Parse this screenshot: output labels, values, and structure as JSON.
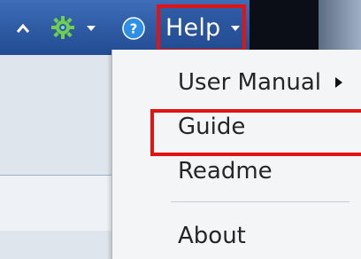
{
  "toolbar": {
    "icons": {
      "collapse": "caret-up-icon",
      "settings": "gear-icon",
      "settings_dropdown": "caret-down-icon",
      "help": "question-circle-icon"
    },
    "help_menu_label": "Help",
    "help_circle_glyph": "?"
  },
  "help_menu": {
    "items": [
      {
        "label": "User Manual",
        "has_submenu": true
      },
      {
        "label": "Guide",
        "highlighted": true
      },
      {
        "label": "Readme"
      },
      {
        "label": "About"
      }
    ]
  },
  "colors": {
    "toolbar": "#2d5aa3",
    "highlight_border": "#e11313",
    "menu_background": "#f4f5f7",
    "menu_text": "#262626"
  }
}
